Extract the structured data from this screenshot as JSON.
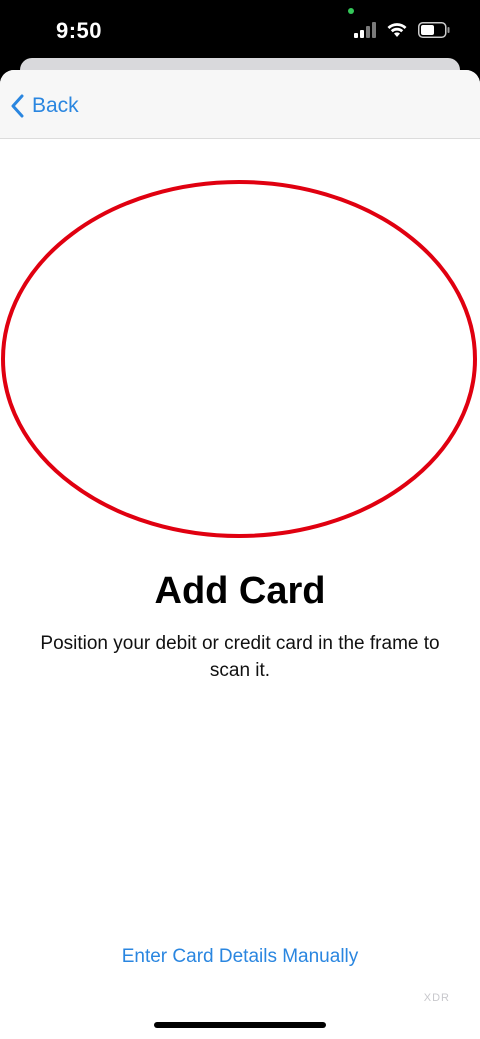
{
  "status_bar": {
    "time": "9:50",
    "icons": [
      "cellular-signal-icon",
      "wifi-icon",
      "battery-icon"
    ]
  },
  "nav": {
    "back_label": "Back",
    "back_icon": "chevron-left-icon"
  },
  "main": {
    "title": "Add Card",
    "subtitle": "Position your debit or credit card in the frame to scan it.",
    "manual_entry_label": "Enter Card Details Manually"
  },
  "watermark": "XDR",
  "colors": {
    "accent": "#2a86e0",
    "frame_outline": "#e00010",
    "nav_background": "#f7f7f7"
  }
}
